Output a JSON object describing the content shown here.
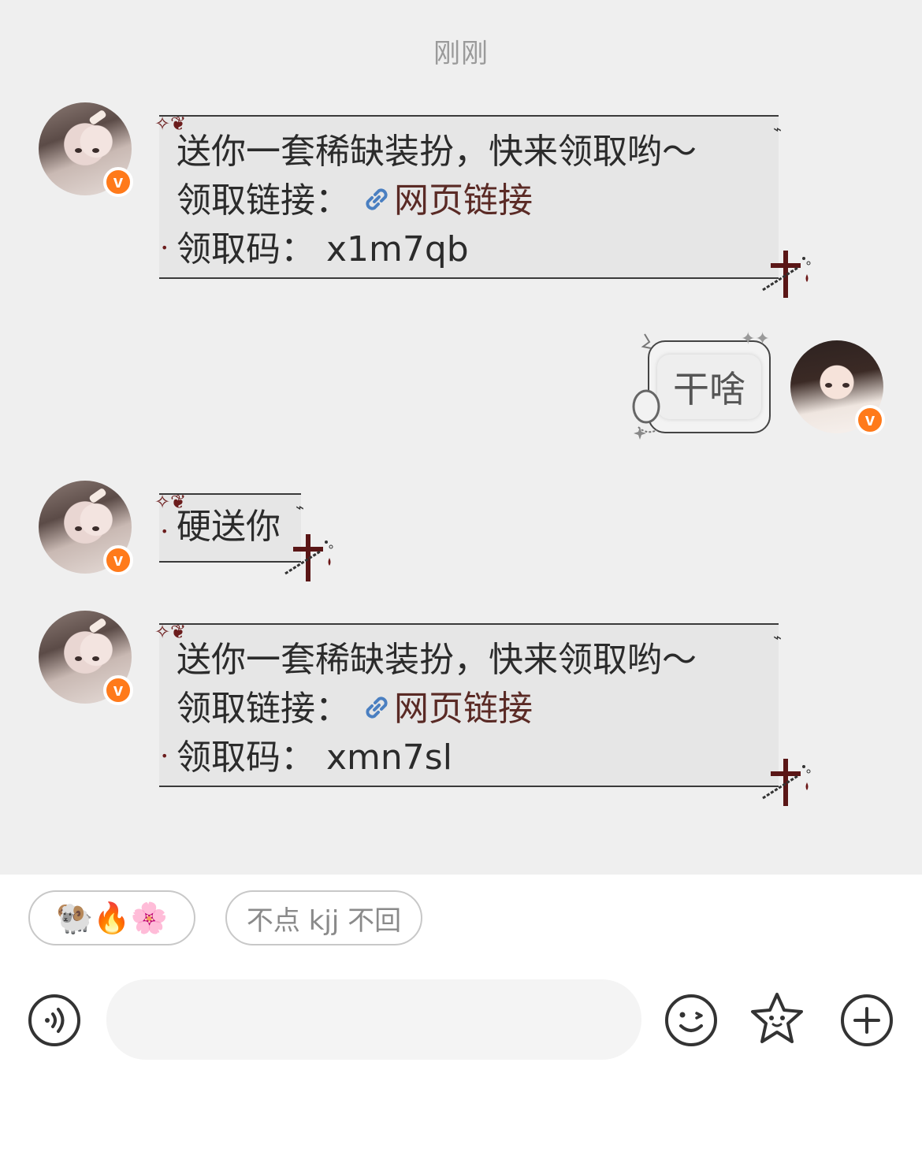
{
  "timestamp": "刚刚",
  "messages": [
    {
      "side": "left",
      "line1": "送你一套稀缺装扮，快来领取哟～",
      "line2_label": "领取链接：",
      "link_text": "网页链接",
      "line3": "领取码：  x1m7qb"
    },
    {
      "side": "right",
      "text": "干啥"
    },
    {
      "side": "left",
      "text": "硬送你"
    },
    {
      "side": "left",
      "line1": "送你一套稀缺装扮，快来领取哟～",
      "line2_label": "领取链接：",
      "link_text": "网页链接",
      "line3": "领取码：  xmn7sl"
    }
  ],
  "badge_letter": "v",
  "quick_replies": [
    {
      "label": "🐏🔥🌸"
    },
    {
      "label": "不点 kjj 不回"
    }
  ],
  "input": {
    "placeholder": ""
  },
  "icons": {
    "voice": "voice-icon",
    "emoji": "emoji-icon",
    "sticker": "star-sticker-icon",
    "more": "plus-icon"
  },
  "colors": {
    "chat_bg": "#efefef",
    "badge": "#ff7a1a",
    "link": "#5a2a25",
    "link_icon": "#4a7fc1"
  }
}
